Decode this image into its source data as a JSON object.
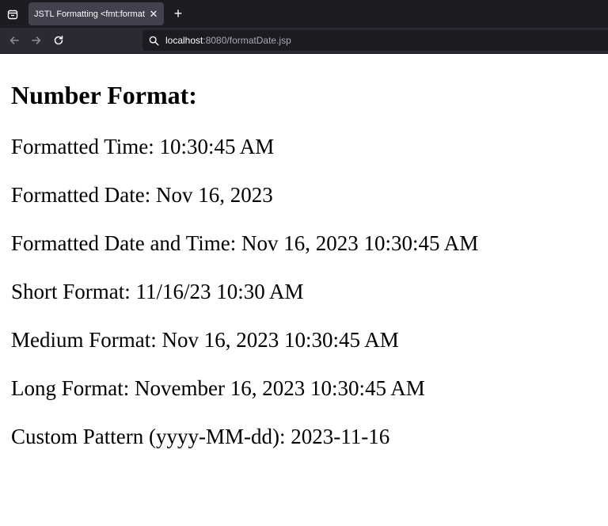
{
  "browser": {
    "tab_title": "JSTL Formatting <fmt:formatDate>",
    "tab_close_glyph": "✕",
    "new_tab_glyph": "+",
    "url_host": "localhost",
    "url_rest": ":8080/formatDate.jsp"
  },
  "page": {
    "heading": "Number Format:",
    "lines": [
      "Formatted Time: 10:30:45 AM",
      "Formatted Date: Nov 16, 2023",
      "Formatted Date and Time: Nov 16, 2023 10:30:45 AM",
      "Short Format: 11/16/23 10:30 AM",
      "Medium Format: Nov 16, 2023 10:30:45 AM",
      "Long Format: November 16, 2023 10:30:45 AM",
      "Custom Pattern (yyyy-MM-dd): 2023-11-16"
    ]
  },
  "colors": {
    "tab_strip_bg": "#1c1b22",
    "active_tab_bg": "#42414d",
    "nav_bar_bg": "#2b2a33",
    "page_bg": "#ffffff",
    "text": "#000000"
  }
}
